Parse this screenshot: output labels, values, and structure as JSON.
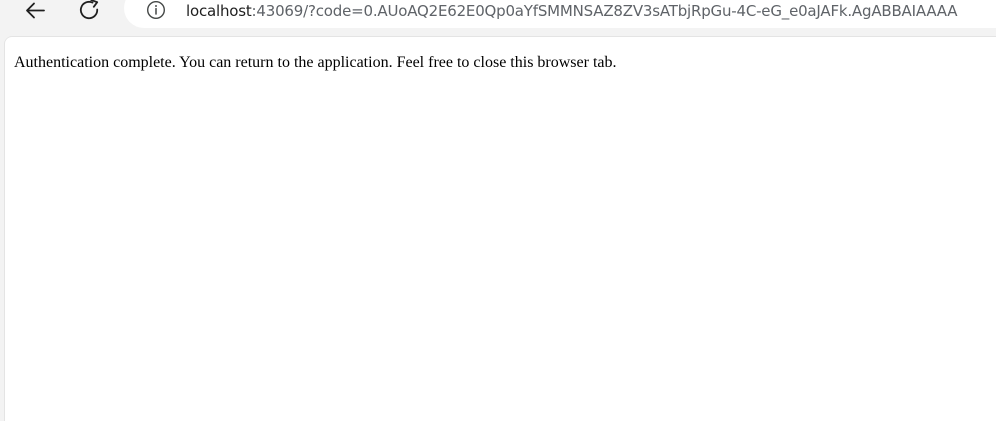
{
  "toolbar": {
    "back_icon": "arrow-left-icon",
    "reload_icon": "reload-icon",
    "address_bar": {
      "info_icon": "info-icon",
      "host": "localhost",
      "rest": ":43069/?code=0.AUoAQ2E62E0Qp0aYfSMMNSAZ8ZV3sATbjRpGu-4C-eG_e0aJAFk.AgABBAIAAAA"
    }
  },
  "page": {
    "message": "Authentication complete. You can return to the application. Feel free to close this browser tab."
  }
}
